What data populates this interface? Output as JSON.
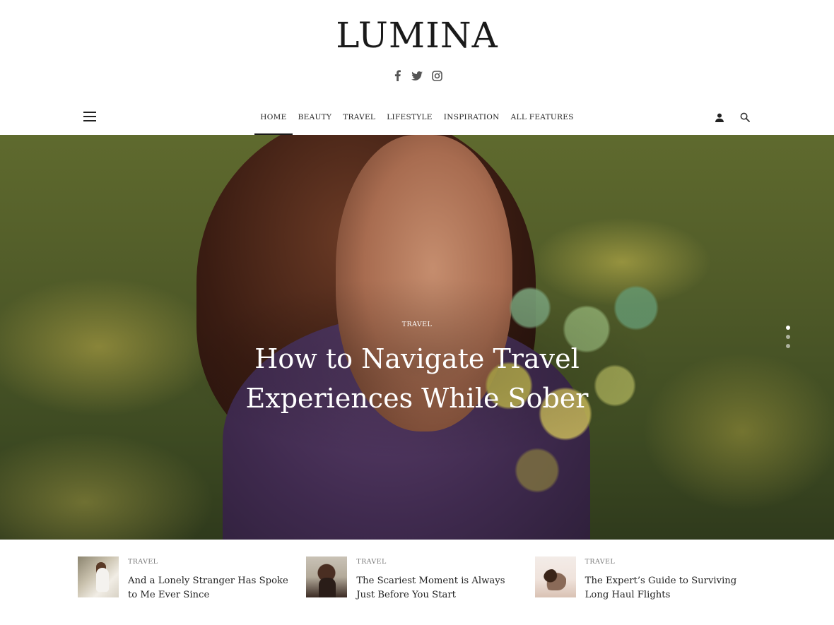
{
  "brand": {
    "logo": "LUMINA"
  },
  "social": [
    {
      "name": "facebook-icon"
    },
    {
      "name": "twitter-icon"
    },
    {
      "name": "instagram-icon"
    }
  ],
  "nav": {
    "items": [
      {
        "label": "HOME",
        "active": true
      },
      {
        "label": "BEAUTY"
      },
      {
        "label": "TRAVEL"
      },
      {
        "label": "LIFESTYLE"
      },
      {
        "label": "INSPIRATION"
      },
      {
        "label": "ALL FEATURES"
      }
    ],
    "icons": [
      "hamburger-menu-icon",
      "user-icon",
      "search-icon"
    ]
  },
  "hero": {
    "category": "TRAVEL",
    "title": "How to Navigate Travel Experiences While Sober",
    "slides": 3,
    "active_slide": 1
  },
  "articles": [
    {
      "category": "TRAVEL",
      "title": "And a Lonely Stranger Has Spoke to Me Ever Since"
    },
    {
      "category": "TRAVEL",
      "title": "The Scariest Moment is Always Just Before You Start"
    },
    {
      "category": "TRAVEL",
      "title": "The Expert’s Guide to Surviving Long Haul Flights"
    }
  ],
  "colors": {
    "text": "#1d1d1d",
    "muted": "#7a7a7a",
    "background": "#ffffff"
  }
}
